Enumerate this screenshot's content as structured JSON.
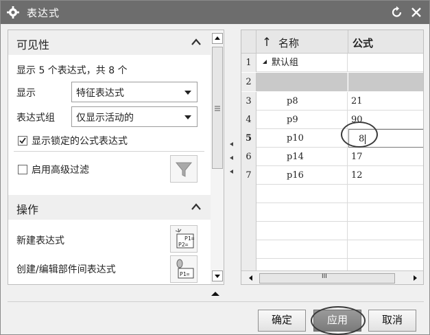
{
  "window": {
    "title": "表达式"
  },
  "visibility": {
    "section_title": "可见性",
    "summary": "显示 5 个表达式，共 8 个",
    "display_label": "显示",
    "display_value": "特征表达式",
    "group_label": "表达式组",
    "group_value": "仅显示活动的",
    "show_locked_label": "显示锁定的公式表达式",
    "show_locked_checked": true,
    "advanced_filter_label": "启用高级过滤",
    "advanced_filter_checked": false
  },
  "operations": {
    "section_title": "操作",
    "new_expression_label": "新建表达式",
    "create_edit_label": "创建/编辑部件间表达式",
    "new_icon_text_top": "P1=",
    "new_icon_text_bottom": "P2=",
    "edit_icon_text": "P1="
  },
  "table": {
    "columns": [
      "名称",
      "公式"
    ],
    "rows": [
      {
        "num": "1",
        "name": "默认组",
        "formula": "",
        "group": true
      },
      {
        "num": "2",
        "name": "",
        "formula": "",
        "selected": true
      },
      {
        "num": "3",
        "name": "p8",
        "formula": "21"
      },
      {
        "num": "4",
        "name": "p9",
        "formula": "90"
      },
      {
        "num": "5",
        "name": "p10",
        "formula": "8",
        "editing": true
      },
      {
        "num": "6",
        "name": "p14",
        "formula": "17"
      },
      {
        "num": "7",
        "name": "p16",
        "formula": "12"
      }
    ],
    "scroll_glyph": "III"
  },
  "buttons": {
    "ok": "确定",
    "apply": "应用",
    "cancel": "取消"
  },
  "colors": {
    "titlebar": "#6d6d6d",
    "apply_button": "#8a8a8a",
    "selected_row": "#c9c9c9"
  }
}
